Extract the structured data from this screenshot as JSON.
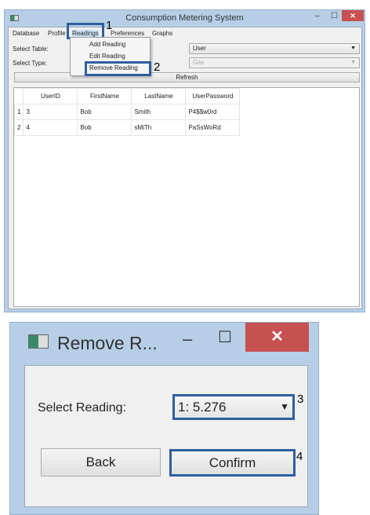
{
  "main_window": {
    "title": "Consumption Metering System",
    "minimize": "–",
    "maximize": "☐",
    "close": "✕"
  },
  "menu": {
    "items": [
      "Database",
      "Profile",
      "Readings",
      "Preferences",
      "Graphs"
    ]
  },
  "readings_menu": {
    "items": [
      "Add Reading",
      "Edit Reading",
      "Remove Reading"
    ]
  },
  "form": {
    "select_table_label": "Select Table:",
    "select_table_value": "User",
    "select_type_label": "Select Type:",
    "select_type_value": "Gas",
    "refresh_label": "Refresh"
  },
  "table": {
    "columns": [
      "UserID",
      "FirstName",
      "LastName",
      "UserPassword"
    ],
    "rows": [
      {
        "index": "1",
        "cells": [
          "3",
          "Bob",
          "Smith",
          "P4$$w0rd"
        ]
      },
      {
        "index": "2",
        "cells": [
          "4",
          "Bob",
          "sMiTh",
          "PaSsWoRd"
        ]
      }
    ]
  },
  "annotations": [
    "1",
    "2",
    "3",
    "4"
  ],
  "dialog": {
    "title": "Remove R...",
    "minimize": "–",
    "maximize": "☐",
    "close": "✕",
    "select_label": "Select Reading:",
    "select_value": "1: 5.276",
    "back_label": "Back",
    "confirm_label": "Confirm"
  },
  "colors": {
    "highlight": "#2f5f9e",
    "close": "#c75050",
    "frame": "#b7cfe6"
  }
}
